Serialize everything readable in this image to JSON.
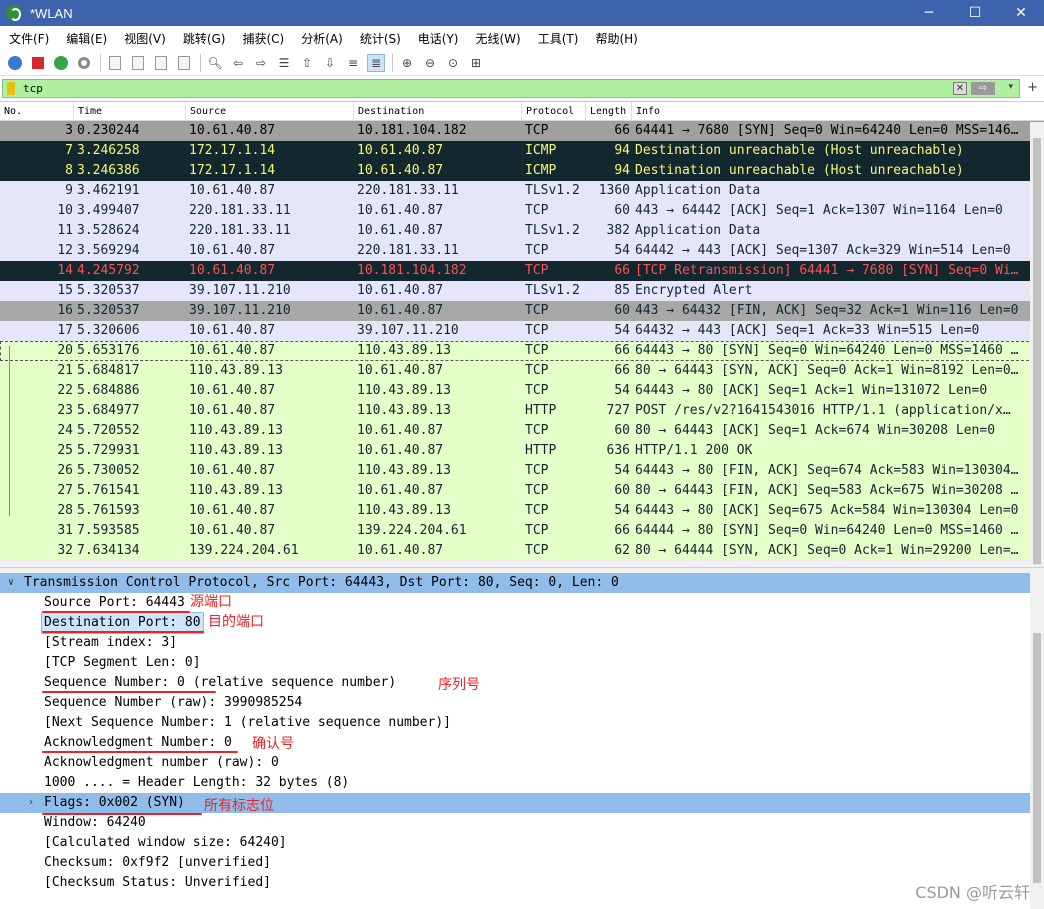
{
  "window": {
    "title": "*WLAN",
    "controls": [
      "─",
      "☐",
      "✕"
    ]
  },
  "menu": [
    "文件(F)",
    "编辑(E)",
    "视图(V)",
    "跳转(G)",
    "捕获(C)",
    "分析(A)",
    "统计(S)",
    "电话(Y)",
    "无线(W)",
    "工具(T)",
    "帮助(H)"
  ],
  "filter": {
    "value": "tcp",
    "clear_icon": "✕",
    "apply_icon": "⇨",
    "dropdown_icon": "▾",
    "add_icon": "+"
  },
  "packet_list": {
    "columns": [
      "No.",
      "Time",
      "Source",
      "Destination",
      "Protocol",
      "Length",
      "Info"
    ],
    "rows": [
      {
        "no": "3",
        "time": "0.230244",
        "src": "10.61.40.87",
        "dst": "10.181.104.182",
        "proto": "TCP",
        "len": "66",
        "info": "64441 → 7680 [SYN] Seq=0 Win=64240 Len=0 MSS=146…",
        "style": "gray"
      },
      {
        "no": "7",
        "time": "3.246258",
        "src": "172.17.1.14",
        "dst": "10.61.40.87",
        "proto": "ICMP",
        "len": "94",
        "info": "Destination unreachable (Host unreachable)",
        "style": "dark"
      },
      {
        "no": "8",
        "time": "3.246386",
        "src": "172.17.1.14",
        "dst": "10.61.40.87",
        "proto": "ICMP",
        "len": "94",
        "info": "Destination unreachable (Host unreachable)",
        "style": "dark"
      },
      {
        "no": "9",
        "time": "3.462191",
        "src": "10.61.40.87",
        "dst": "220.181.33.11",
        "proto": "TLSv1.2",
        "len": "1360",
        "info": "Application Data",
        "style": "lav"
      },
      {
        "no": "10",
        "time": "3.499407",
        "src": "220.181.33.11",
        "dst": "10.61.40.87",
        "proto": "TCP",
        "len": "60",
        "info": "443 → 64442 [ACK] Seq=1 Ack=1307 Win=1164 Len=0",
        "style": "lav"
      },
      {
        "no": "11",
        "time": "3.528624",
        "src": "220.181.33.11",
        "dst": "10.61.40.87",
        "proto": "TLSv1.2",
        "len": "382",
        "info": "Application Data",
        "style": "lav"
      },
      {
        "no": "12",
        "time": "3.569294",
        "src": "10.61.40.87",
        "dst": "220.181.33.11",
        "proto": "TCP",
        "len": "54",
        "info": "64442 → 443 [ACK] Seq=1307 Ack=329 Win=514 Len=0",
        "style": "lav"
      },
      {
        "no": "14",
        "time": "4.245792",
        "src": "10.61.40.87",
        "dst": "10.181.104.182",
        "proto": "TCP",
        "len": "66",
        "info": "[TCP Retransmission] 64441 → 7680 [SYN] Seq=0 Wi…",
        "style": "sel"
      },
      {
        "no": "15",
        "time": "5.320537",
        "src": "39.107.11.210",
        "dst": "10.61.40.87",
        "proto": "TLSv1.2",
        "len": "85",
        "info": "Encrypted Alert",
        "style": "lav"
      },
      {
        "no": "16",
        "time": "5.320537",
        "src": "39.107.11.210",
        "dst": "10.61.40.87",
        "proto": "TCP",
        "len": "60",
        "info": "443 → 64432 [FIN, ACK] Seq=32 Ack=1 Win=116 Len=0",
        "style": "gray2"
      },
      {
        "no": "17",
        "time": "5.320606",
        "src": "10.61.40.87",
        "dst": "39.107.11.210",
        "proto": "TCP",
        "len": "54",
        "info": "64432 → 443 [ACK] Seq=1 Ack=33 Win=515 Len=0",
        "style": "lav"
      },
      {
        "no": "20",
        "time": "5.653176",
        "src": "10.61.40.87",
        "dst": "110.43.89.13",
        "proto": "TCP",
        "len": "66",
        "info": "64443 → 80 [SYN] Seq=0 Win=64240 Len=0 MSS=1460 …",
        "style": "green",
        "selected": true
      },
      {
        "no": "21",
        "time": "5.684817",
        "src": "110.43.89.13",
        "dst": "10.61.40.87",
        "proto": "TCP",
        "len": "66",
        "info": "80 → 64443 [SYN, ACK] Seq=0 Ack=1 Win=8192 Len=0…",
        "style": "green"
      },
      {
        "no": "22",
        "time": "5.684886",
        "src": "10.61.40.87",
        "dst": "110.43.89.13",
        "proto": "TCP",
        "len": "54",
        "info": "64443 → 80 [ACK] Seq=1 Ack=1 Win=131072 Len=0",
        "style": "green"
      },
      {
        "no": "23",
        "time": "5.684977",
        "src": "10.61.40.87",
        "dst": "110.43.89.13",
        "proto": "HTTP",
        "len": "727",
        "info": "POST /res/v2?1641543016 HTTP/1.1  (application/x…",
        "style": "green"
      },
      {
        "no": "24",
        "time": "5.720552",
        "src": "110.43.89.13",
        "dst": "10.61.40.87",
        "proto": "TCP",
        "len": "60",
        "info": "80 → 64443 [ACK] Seq=1 Ack=674 Win=30208 Len=0",
        "style": "green"
      },
      {
        "no": "25",
        "time": "5.729931",
        "src": "110.43.89.13",
        "dst": "10.61.40.87",
        "proto": "HTTP",
        "len": "636",
        "info": "HTTP/1.1 200 OK",
        "style": "green"
      },
      {
        "no": "26",
        "time": "5.730052",
        "src": "10.61.40.87",
        "dst": "110.43.89.13",
        "proto": "TCP",
        "len": "54",
        "info": "64443 → 80 [FIN, ACK] Seq=674 Ack=583 Win=130304…",
        "style": "green"
      },
      {
        "no": "27",
        "time": "5.761541",
        "src": "110.43.89.13",
        "dst": "10.61.40.87",
        "proto": "TCP",
        "len": "60",
        "info": "80 → 64443 [FIN, ACK] Seq=583 Ack=675 Win=30208 …",
        "style": "green"
      },
      {
        "no": "28",
        "time": "5.761593",
        "src": "10.61.40.87",
        "dst": "110.43.89.13",
        "proto": "TCP",
        "len": "54",
        "info": "64443 → 80 [ACK] Seq=675 Ack=584 Win=130304 Len=0",
        "style": "green"
      },
      {
        "no": "31",
        "time": "7.593585",
        "src": "10.61.40.87",
        "dst": "139.224.204.61",
        "proto": "TCP",
        "len": "66",
        "info": "64444 → 80 [SYN] Seq=0 Win=64240 Len=0 MSS=1460 …",
        "style": "green"
      },
      {
        "no": "32",
        "time": "7.634134",
        "src": "139.224.204.61",
        "dst": "10.61.40.87",
        "proto": "TCP",
        "len": "62",
        "info": "80 → 64444 [SYN, ACK] Seq=0 Ack=1 Win=29200 Len=…",
        "style": "green"
      }
    ]
  },
  "details": {
    "top": "Transmission Control Protocol, Src Port: 64443, Dst Port: 80, Seq: 0, Len: 0",
    "lines": [
      "Source Port: 64443",
      "Destination Port: 80",
      "[Stream index: 3]",
      "[TCP Segment Len: 0]",
      "Sequence Number: 0    (relative sequence number)",
      "Sequence Number (raw): 3990985254",
      "[Next Sequence Number: 1    (relative sequence number)]",
      "Acknowledgment Number: 0",
      "Acknowledgment number (raw): 0",
      "1000 .... = Header Length: 32 bytes (8)",
      "Flags: 0x002 (SYN)",
      "Window: 64240",
      "[Calculated window size: 64240]",
      "Checksum: 0xf9f2 [unverified]",
      "[Checksum Status: Unverified]"
    ],
    "annotations": {
      "source_port": "源端口",
      "dest_port": "目的端口",
      "seq": "序列号",
      "ack": "确认号",
      "flags": "所有标志位"
    },
    "annotation_color": "#e8242a"
  },
  "watermark": "CSDN @听云轩"
}
